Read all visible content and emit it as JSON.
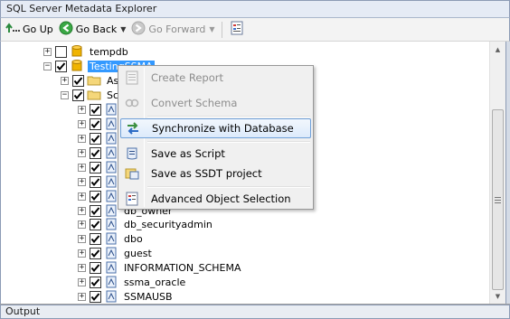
{
  "window": {
    "title": "SQL Server Metadata Explorer"
  },
  "toolbar": {
    "go_up": "Go Up",
    "go_back": "Go Back",
    "go_forward": "Go Forward"
  },
  "tree": {
    "nodes": [
      {
        "label": "tempdb",
        "checked": false,
        "icon": "database-icon"
      },
      {
        "label": "TestingSSMA",
        "checked": true,
        "icon": "database-icon",
        "selected": true
      },
      {
        "label": "As",
        "checked": true,
        "icon": "folder-icon"
      },
      {
        "label": "Sc",
        "checked": true,
        "icon": "folder-icon"
      },
      {
        "label": "db_owner",
        "checked": true,
        "icon": "schema-icon"
      },
      {
        "label": "db_securityadmin",
        "checked": true,
        "icon": "schema-icon"
      },
      {
        "label": "dbo",
        "checked": true,
        "icon": "schema-icon"
      },
      {
        "label": "guest",
        "checked": true,
        "icon": "schema-icon"
      },
      {
        "label": "INFORMATION_SCHEMA",
        "checked": true,
        "icon": "schema-icon"
      },
      {
        "label": "ssma_oracle",
        "checked": true,
        "icon": "schema-icon"
      },
      {
        "label": "SSMAUSB",
        "checked": true,
        "icon": "schema-icon"
      }
    ]
  },
  "context_menu": {
    "items": [
      {
        "label": "Create Report",
        "enabled": false,
        "icon": "report-icon"
      },
      {
        "label": "Convert Schema",
        "enabled": false,
        "icon": "convert-icon"
      },
      {
        "label": "Synchronize with Database",
        "enabled": true,
        "icon": "sync-icon",
        "highlighted": true
      },
      {
        "label": "Save as Script",
        "enabled": true,
        "icon": "script-icon"
      },
      {
        "label": "Save as SSDT project",
        "enabled": true,
        "icon": "ssdt-icon"
      },
      {
        "label": "Advanced Object Selection",
        "enabled": true,
        "icon": "selection-icon"
      }
    ]
  },
  "output_panel": {
    "title": "Output"
  },
  "colors": {
    "selection": "#3399ff",
    "menu_highlight_border": "#6fa0d8",
    "toolbar_back_icon": "#2f9b3a"
  }
}
